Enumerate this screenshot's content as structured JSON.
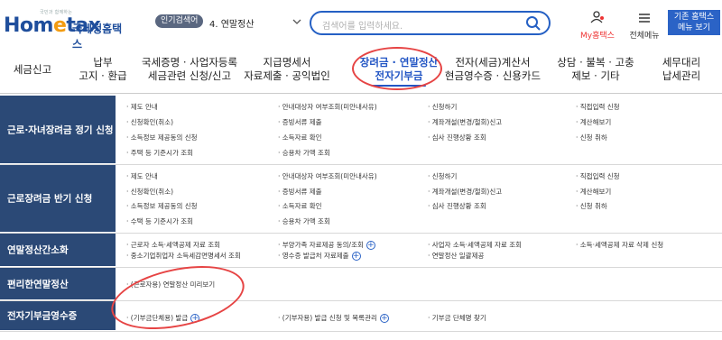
{
  "header": {
    "logo_small": "국민과 함께하는",
    "logo_text": "Hometax",
    "logo_kr": "국세청홈택스",
    "popular_label": "인기검색어",
    "popular_keyword": "4. 연말정산",
    "search_placeholder": "검색어를 입력하세요.",
    "myhome": "My홈택스",
    "allmenu": "전체메뉴",
    "basic_button": [
      "기존 홈택스",
      "메뉴 보기"
    ]
  },
  "nav": [
    {
      "lines": [
        "세금신고"
      ]
    },
    {
      "lines": [
        "납부",
        "고지 · 환급"
      ]
    },
    {
      "lines": [
        "국세증명 · 사업자등록",
        "세금관련 신청/신고"
      ]
    },
    {
      "lines": [
        "지급명세서",
        "자료제출 · 공익법인"
      ]
    },
    {
      "lines": [
        "장려금 · 연말정산",
        "전자기부금"
      ]
    },
    {
      "lines": [
        "전자(세금)계산서",
        "현금영수증 · 신용카드"
      ]
    },
    {
      "lines": [
        "상담 · 불복 · 고충",
        "제보 · 기타"
      ]
    },
    {
      "lines": [
        "세무대리",
        "납세관리"
      ]
    }
  ],
  "menu": [
    {
      "title": "근로·자녀장려금 정기 신청",
      "items": [
        [
          "제도 안내",
          "안내대상자 여부조회(미안내사유)",
          "신청하기",
          "직접입력 신청"
        ],
        [
          "신청확인(취소)",
          "증빙서류 제출",
          "계좌개설(변경/철회)신고",
          "계산해보기"
        ],
        [
          "소득정보 제공동의 신청",
          "소득자료 확인",
          "심사 진행상황 조회",
          "신청 취하"
        ],
        [
          "주택 등 기준시가 조회",
          "승용차 가액 조회",
          "",
          ""
        ]
      ]
    },
    {
      "title": "근로장려금 반기 신청",
      "items": [
        [
          "제도 안내",
          "안내대상자 여부조회(미안내사유)",
          "신청하기",
          "직접입력 신청"
        ],
        [
          "신청확인(취소)",
          "증빙서류 제출",
          "계좌개설(변경/철회)신고",
          "계산해보기"
        ],
        [
          "소득정보 제공동의 신청",
          "소득자료 확인",
          "심사 진행상황 조회",
          "신청 취하"
        ],
        [
          "수택 등 기준시가 조회",
          "승용차 가액 조회",
          "",
          ""
        ]
      ]
    },
    {
      "title": "연말정산간소화",
      "items": [
        [
          "근로자 소득·세액공제 자료 조회",
          "부양가족 자료제공 동의/조회",
          "사업자 소득·세액공제 자료 조회",
          "소득·세액공제 자료 삭제 신청"
        ],
        [
          "중소기업취업자 소득세감면명세서 조회",
          "영수증 발급처 자료제출",
          "연말정산 일괄제공",
          ""
        ]
      ]
    },
    {
      "title": "편리한연말정산",
      "items": [
        [
          "(근로자용) 연말정산 미리보기",
          "",
          "",
          ""
        ]
      ]
    },
    {
      "title": "전자기부금영수증",
      "items": [
        [
          "(기부금단체용) 발급",
          "(기부자용) 발급 신청 및 목록관리",
          "기부금 단체명 찾기",
          ""
        ]
      ]
    }
  ]
}
